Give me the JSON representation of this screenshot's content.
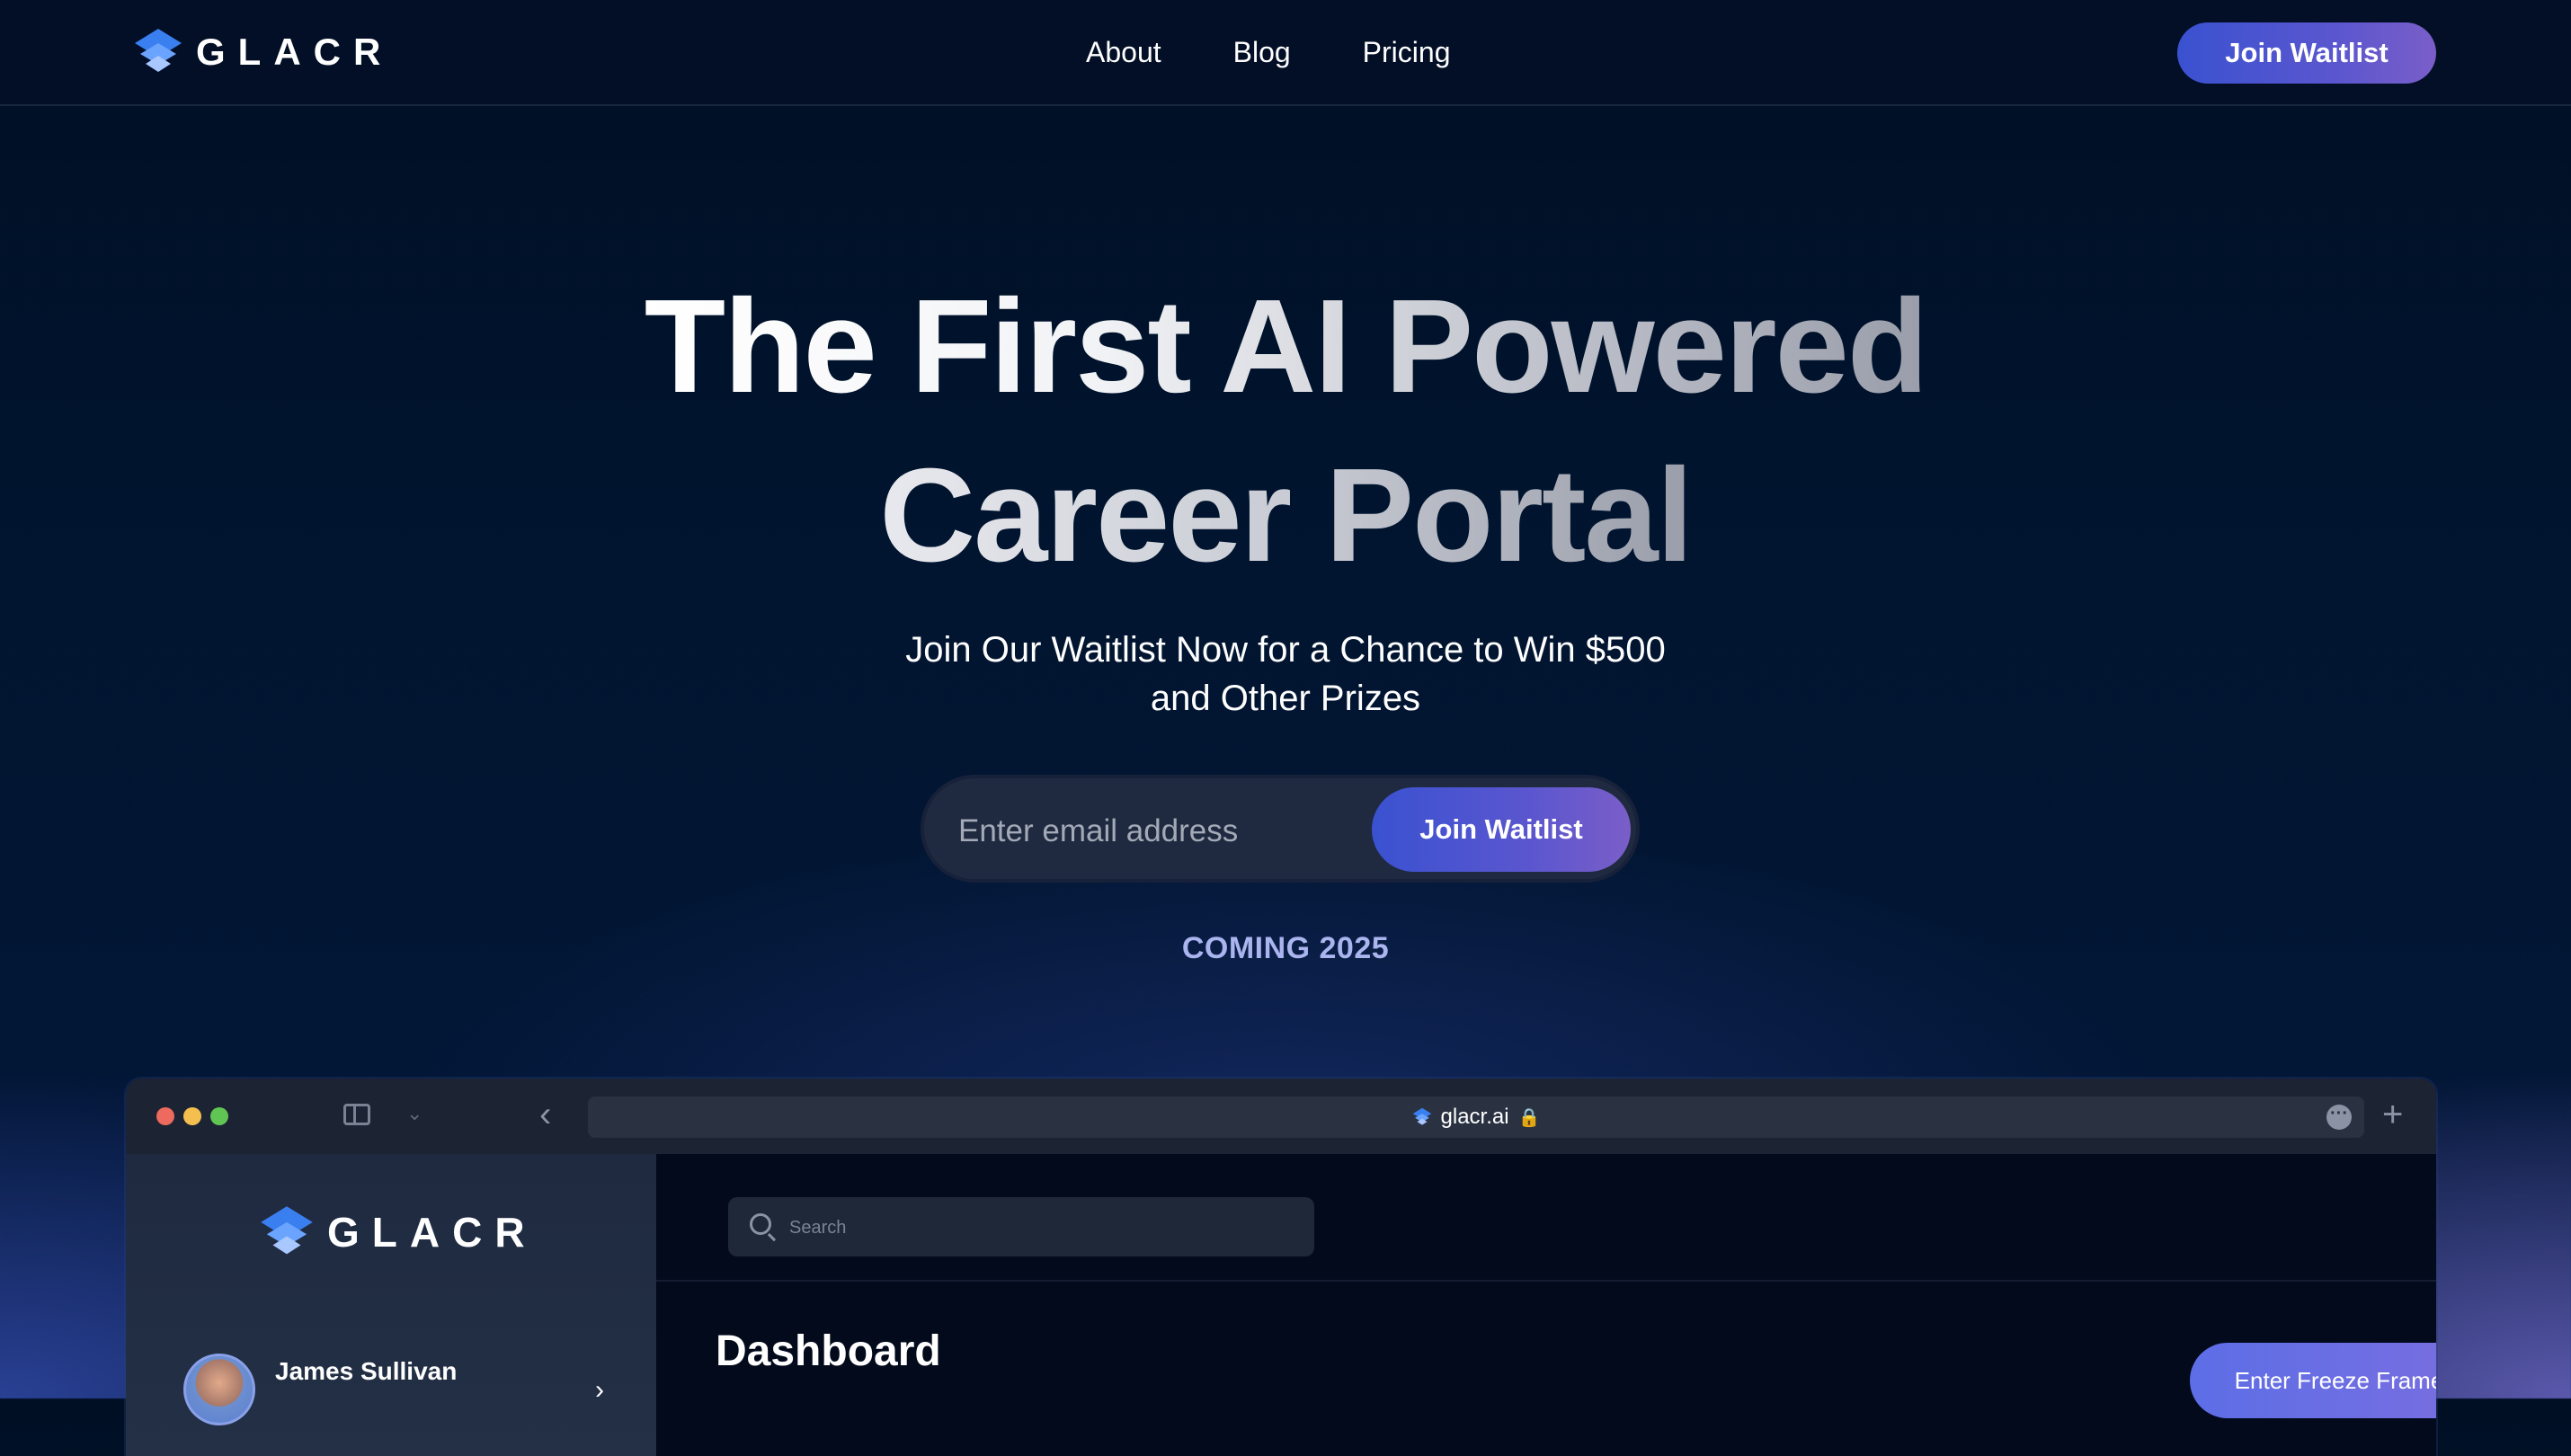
{
  "nav": {
    "brand": "GLACR",
    "links": [
      "About",
      "Blog",
      "Pricing"
    ],
    "cta_label": "Join Waitlist"
  },
  "hero": {
    "title_line1": "The First AI Powered",
    "title_line2": "Career Portal",
    "subtitle_line1": "Join Our Waitlist Now for a Chance to Win $500",
    "subtitle_line2": "and Other Prizes",
    "email_placeholder": "Enter email address",
    "cta_label": "Join Waitlist",
    "coming": "COMING 2025"
  },
  "browser": {
    "url": "glacr.ai",
    "icons": {
      "close": "red-dot",
      "minimize": "yellow-dot",
      "maximize": "green-dot",
      "sidebar": "sidebar-toggle-icon",
      "dropdown": "chevron-down-icon",
      "back": "chevron-left-icon",
      "lock": "lock-icon",
      "more": "more-icon",
      "new_tab": "plus-icon"
    }
  },
  "app": {
    "brand": "GLACR",
    "user_name": "James Sullivan",
    "search_placeholder": "Search",
    "page_title": "Dashboard",
    "freeze_button_label": "Enter Freeze Frame"
  },
  "colors": {
    "accent_start": "#3a52d0",
    "accent_end": "#7a5ec8",
    "coming_text": "#aab4ee",
    "page_background": "#011530"
  }
}
